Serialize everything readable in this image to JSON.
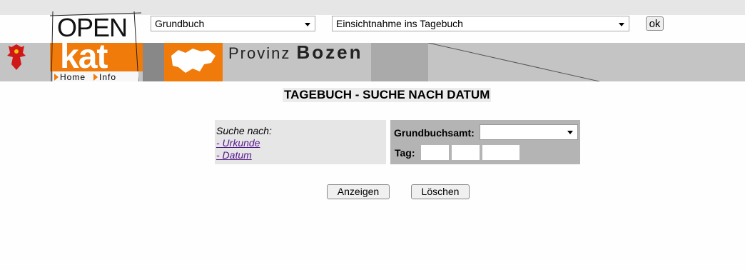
{
  "header": {
    "logo_open": "OPEN",
    "logo_kat": "kat",
    "nav": [
      {
        "label": "Home"
      },
      {
        "label": "Info"
      }
    ],
    "province_prefix": "Provinz",
    "province_name": "Bozen",
    "select_register": "Grundbuch",
    "select_action": "Einsichtnahme ins Tagebuch",
    "ok_label": "ok"
  },
  "colors": {
    "accent": "#f07b0a",
    "band": "#c4c4c4",
    "panel_right": "#b4b4b4",
    "panel_left": "#e6e6e6"
  },
  "main": {
    "title": "TAGEBUCH - SUCHE NACH DATUM",
    "search_by_label": "Suche nach:",
    "links": [
      {
        "label": "- Urkunde"
      },
      {
        "label": "- Datum"
      }
    ],
    "office_label": "Grundbuchsamt:",
    "office_value": "",
    "day_label": "Tag:",
    "date_fields": [
      "",
      "",
      ""
    ]
  },
  "actions": {
    "show_label": "Anzeigen",
    "clear_label": "Löschen"
  }
}
